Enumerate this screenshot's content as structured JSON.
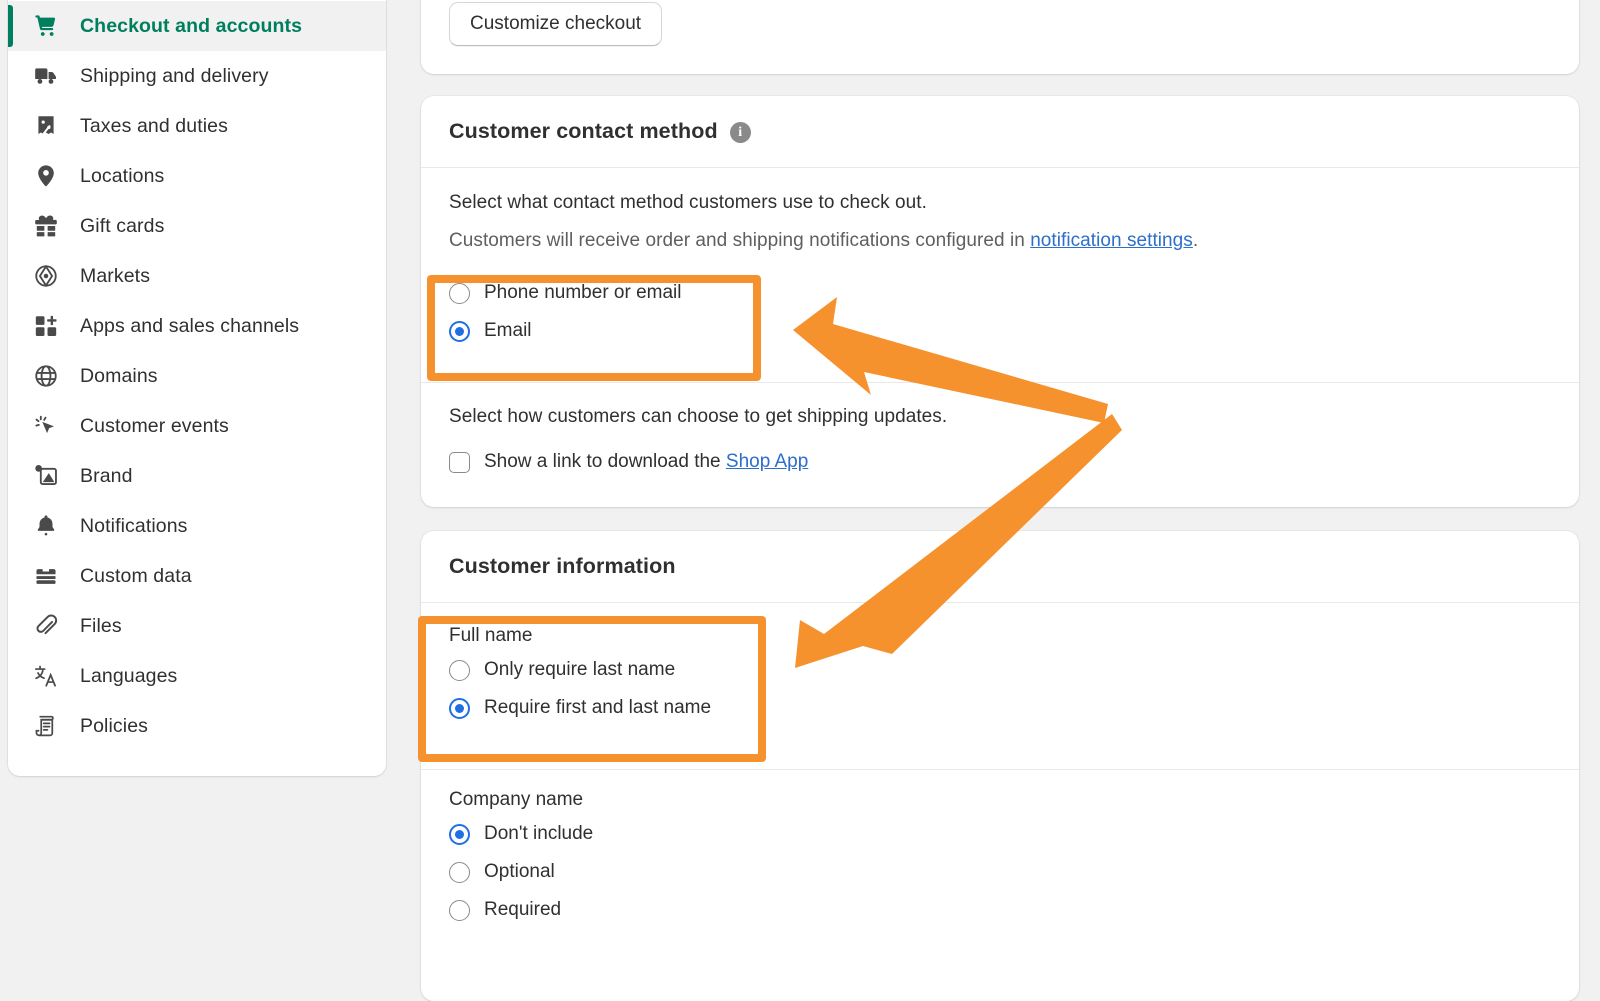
{
  "theme": {
    "page_background": "#f1f1f1",
    "card_background": "#ffffff",
    "accent_green": "#007f5f",
    "link_blue": "#2c6ecb",
    "radio_blue": "#1f6fe5",
    "annotation_orange": "#f5922e",
    "text_primary": "#303030",
    "text_muted": "#5c5f62"
  },
  "sidebar": {
    "items": [
      {
        "label": "Checkout and accounts",
        "icon": "shopping-cart-icon",
        "selected": true
      },
      {
        "label": "Shipping and delivery",
        "icon": "delivery-truck-icon",
        "selected": false
      },
      {
        "label": "Taxes and duties",
        "icon": "tax-receipt-icon",
        "selected": false
      },
      {
        "label": "Locations",
        "icon": "map-pin-icon",
        "selected": false
      },
      {
        "label": "Gift cards",
        "icon": "gift-icon",
        "selected": false
      },
      {
        "label": "Markets",
        "icon": "globe-compass-icon",
        "selected": false
      },
      {
        "label": "Apps and sales channels",
        "icon": "apps-grid-plus-icon",
        "selected": false
      },
      {
        "label": "Domains",
        "icon": "globe-icon",
        "selected": false
      },
      {
        "label": "Customer events",
        "icon": "cursor-click-icon",
        "selected": false
      },
      {
        "label": "Brand",
        "icon": "brand-image-icon",
        "selected": false
      },
      {
        "label": "Notifications",
        "icon": "bell-icon",
        "selected": false
      },
      {
        "label": "Custom data",
        "icon": "database-icon",
        "selected": false
      },
      {
        "label": "Files",
        "icon": "paperclip-icon",
        "selected": false
      },
      {
        "label": "Languages",
        "icon": "translate-icon",
        "selected": false
      },
      {
        "label": "Policies",
        "icon": "scroll-document-icon",
        "selected": false
      }
    ]
  },
  "top_card": {
    "customize_checkout_label": "Customize checkout"
  },
  "contact_method_card": {
    "title": "Customer contact method",
    "info_icon_glyph": "i",
    "description": "Select what contact method customers use to check out.",
    "notice_prefix": "Customers will receive order and shipping notifications configured in ",
    "notice_link": "notification settings",
    "notice_suffix": ".",
    "options": [
      {
        "label": "Phone number or email",
        "selected": false
      },
      {
        "label": "Email",
        "selected": true
      }
    ],
    "shipping_updates_description": "Select how customers can choose to get shipping updates.",
    "shop_app_prefix": "Show a link to download the ",
    "shop_app_link": "Shop App",
    "shop_app_checked": false
  },
  "customer_information_card": {
    "title": "Customer information",
    "full_name": {
      "label": "Full name",
      "options": [
        {
          "label": "Only require last name",
          "selected": false
        },
        {
          "label": "Require first and last name",
          "selected": true
        }
      ]
    },
    "company_name": {
      "label": "Company name",
      "options": [
        {
          "label": "Don't include",
          "selected": true
        },
        {
          "label": "Optional",
          "selected": false
        },
        {
          "label": "Required",
          "selected": false
        }
      ]
    }
  },
  "annotations": {
    "highlight_boxes": [
      {
        "name": "contact-method-options-highlight",
        "color": "#f5922e"
      },
      {
        "name": "full-name-options-highlight",
        "color": "#f5922e"
      }
    ],
    "arrow": {
      "name": "double-headed-zigzag-arrow",
      "color": "#f5922e",
      "points_to": [
        "contact-method-options-highlight",
        "full-name-options-highlight"
      ]
    }
  }
}
